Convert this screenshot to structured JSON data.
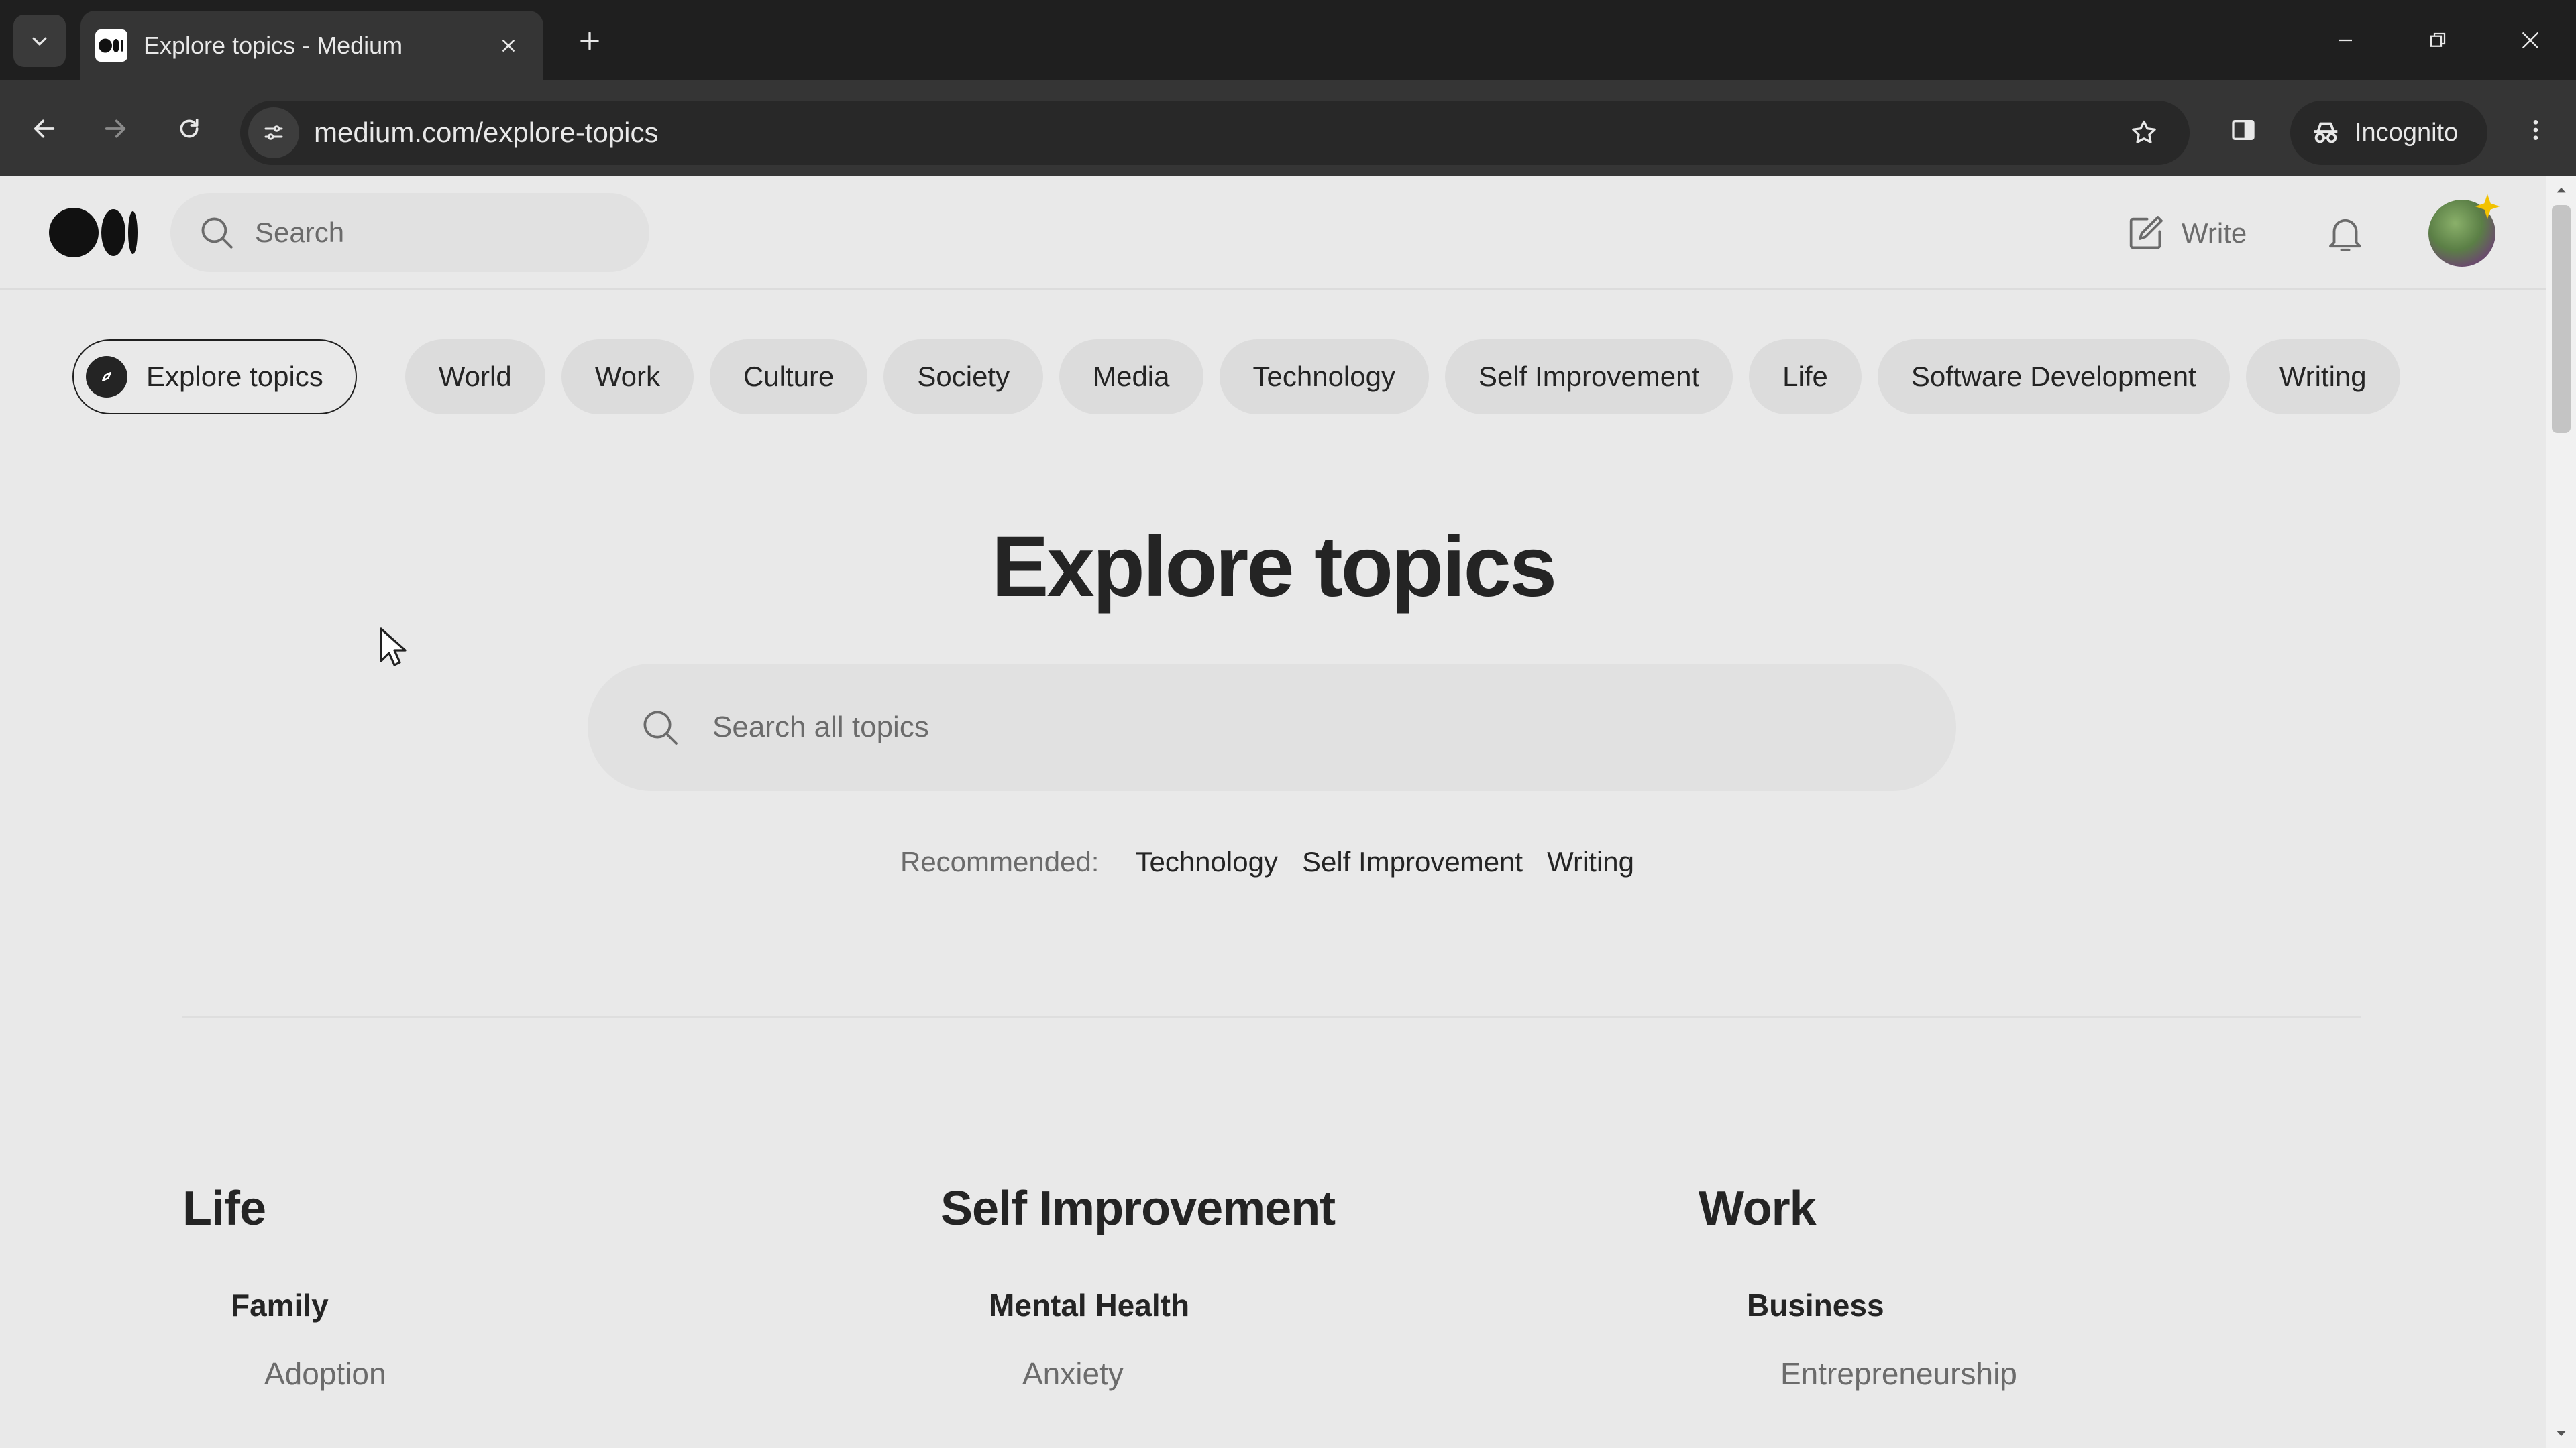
{
  "browser": {
    "tab_title": "Explore topics - Medium",
    "url": "medium.com/explore-topics",
    "incognito_label": "Incognito"
  },
  "header": {
    "search_placeholder": "Search",
    "write_label": "Write"
  },
  "nav": {
    "explore_label": "Explore topics",
    "pills": [
      "World",
      "Work",
      "Culture",
      "Society",
      "Media",
      "Technology",
      "Self Improvement",
      "Life",
      "Software Development",
      "Writing"
    ]
  },
  "main": {
    "title": "Explore topics",
    "search_placeholder": "Search all topics",
    "recommended_label": "Recommended:",
    "recommended": [
      "Technology",
      "Self Improvement",
      "Writing"
    ]
  },
  "columns": [
    {
      "title": "Life",
      "subtopic": "Family",
      "item": "Adoption"
    },
    {
      "title": "Self Improvement",
      "subtopic": "Mental Health",
      "item": "Anxiety"
    },
    {
      "title": "Work",
      "subtopic": "Business",
      "item": "Entrepreneurship"
    }
  ],
  "colors": {
    "chrome_dark": "#1f1f1f",
    "chrome_toolbar": "#353535",
    "page_bg": "#e9e9e9",
    "pill_bg": "#dcdcdc",
    "text_primary": "#242424",
    "text_secondary": "#6b6b6b"
  }
}
